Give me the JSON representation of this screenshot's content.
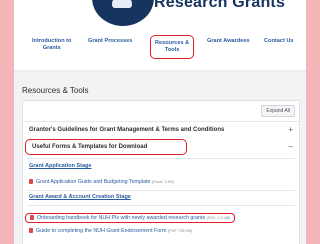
{
  "header": {
    "brand_title": "Research Grants",
    "nav": [
      {
        "label_line1": "Introduction to",
        "label_line2": "Grants"
      },
      {
        "label_line1": "Grant Processes",
        "label_line2": ""
      },
      {
        "label_line1": "Resources &",
        "label_line2": "Tools"
      },
      {
        "label_line1": "Grant Awardees",
        "label_line2": ""
      },
      {
        "label_line1": "Contact Us",
        "label_line2": ""
      }
    ]
  },
  "main": {
    "section_title": "Resources & Tools",
    "expand_all": "Expand All",
    "accordions": [
      {
        "label": "Grantor's Guidelines for Grant Management & Terms and Conditions",
        "toggle": "+"
      },
      {
        "label": "Useful Forms & Templates for Download",
        "toggle": "–"
      }
    ],
    "stages": [
      {
        "title": "Grant Application Stage"
      },
      {
        "title": "Grant Award & Account Creation Stage"
      }
    ],
    "documents": [
      {
        "name": "Grant Application Guide and Budgeting Template",
        "meta": "(Excel, 3 KB)"
      },
      {
        "name": "Onboarding handbook for NUH PIs with newly awarded research grants",
        "meta": "(PDF, 1.2 MB)"
      },
      {
        "name": "Guide to completing the NUH Grant Endorsement Form",
        "meta": "(PDF, 755 KB)"
      }
    ]
  }
}
